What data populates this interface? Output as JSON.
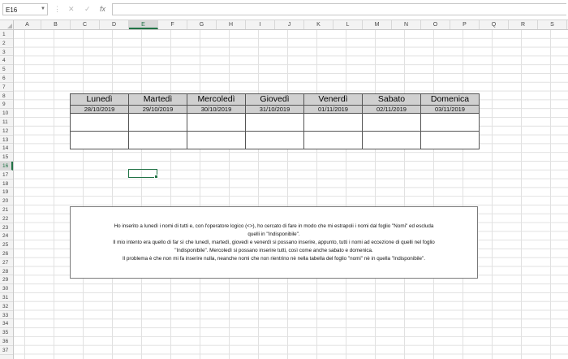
{
  "formula_bar": {
    "name_box": "E16",
    "cancel_glyph": "✕",
    "enter_glyph": "✓",
    "fx_label": "fx",
    "formula": ""
  },
  "columns": [
    "A",
    "B",
    "C",
    "D",
    "E",
    "F",
    "G",
    "H",
    "I",
    "J",
    "K",
    "L",
    "M",
    "N",
    "O",
    "P",
    "Q",
    "R",
    "S"
  ],
  "active_column": "E",
  "rows": [
    "1",
    "2",
    "3",
    "4",
    "5",
    "6",
    "7",
    "8",
    "9",
    "10",
    "11",
    "12",
    "13",
    "14",
    "15",
    "16",
    "17",
    "18",
    "19",
    "20",
    "21",
    "22",
    "23",
    "24",
    "25",
    "26",
    "27",
    "28",
    "29",
    "30",
    "31",
    "32",
    "33",
    "34",
    "35",
    "36",
    "37"
  ],
  "active_row": "16",
  "week_table": {
    "days": [
      "Lunedì",
      "Martedì",
      "Mercoledì",
      "Giovedì",
      "Venerdì",
      "Sabato",
      "Domenica"
    ],
    "dates": [
      "28/10/2019",
      "29/10/2019",
      "30/10/2019",
      "31/10/2019",
      "01/11/2019",
      "02/11/2019",
      "03/11/2019"
    ]
  },
  "note": {
    "lines": [
      "Ho inserito a lunedì i nomi di tutti e, con l'operatore logico (<>), ho cercato di fare in modo che mi estrapoli i nomi dal foglio \"Nomi\" ed escluda",
      "quelli in \"Indisponibile\".",
      "Il mio intento era quello di far sì che lunedì, martedì, giovedì e venerdì si possano inserire, appunto, tutti i nomi ad eccezione di quelli nel foglio",
      "\"Indisponibile\". Mercoledì si possano inserire tutti, così come anche sabato e domenica.",
      "Il problema è che non mi fa inserire nulla, neanche nomi che non rientrino nè nella tabella del foglio \"nomi\" nè in quella \"Indisponibile\"."
    ]
  },
  "colors": {
    "accent": "#217346",
    "header_fill": "#d0d0d0"
  }
}
